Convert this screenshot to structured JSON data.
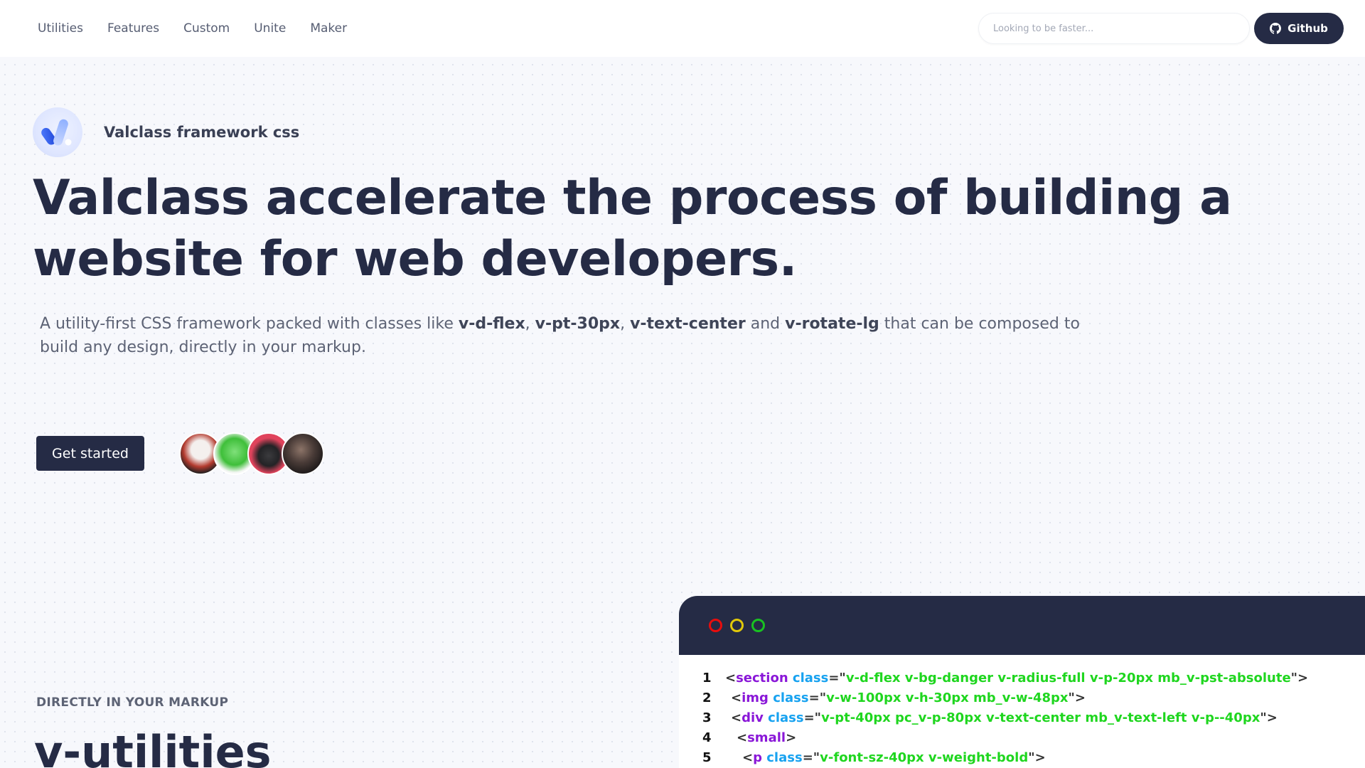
{
  "nav": {
    "links": [
      "Utilities",
      "Features",
      "Custom",
      "Unite",
      "Maker"
    ],
    "search_placeholder": "Looking to be faster...",
    "github_label": "Github"
  },
  "brand": {
    "name": "Valclass framework css",
    "logo_icon": "valclass-logo-icon"
  },
  "hero": {
    "headline_line1": "Valclass accelerate the process of building a",
    "headline_line2": "website for web developers.",
    "sub_1": "A utility-first CSS framework packed with classes like ",
    "kw_1": "v-d-flex",
    "sep_1": ", ",
    "kw_2": "v-pt-30px",
    "sep_2": ", ",
    "kw_3": "v-text-center",
    "sep_3": " and ",
    "kw_4": "v-rotate-lg",
    "sub_2": " that can be composed to build any design, directly in your markup.",
    "cta_label": "Get started"
  },
  "section": {
    "kicker": "DIRECTLY IN YOUR MARKUP",
    "title": "v-utilities"
  },
  "colors": {
    "primary": "#252b45",
    "tag": "#8a17d8",
    "attr": "#17a2f0",
    "string": "#1fd61f",
    "dot_red": "#e80d0d",
    "dot_yellow": "#e0c80a",
    "dot_green": "#19c221"
  },
  "code": {
    "lines": [
      {
        "n": "1",
        "open": "<",
        "tag": "section",
        "attr": "class",
        "eq": "=\"",
        "value": "v-d-flex v-bg-danger v-radius-full v-p-20px mb_v-pst-absolute",
        "close": "\">"
      },
      {
        "n": "2",
        "open": "<",
        "tag": "img",
        "attr": "class",
        "eq": "=\"",
        "value": "v-w-100px v-h-30px mb_v-w-48px",
        "close": "\">"
      },
      {
        "n": "3",
        "open": "<",
        "tag": "div",
        "attr": "class",
        "eq": "=\"",
        "value": "v-pt-40px pc_v-p-80px v-text-center mb_v-text-left v-p--40px",
        "close": "\">"
      },
      {
        "n": "4",
        "open": "<",
        "tag": "small",
        "close": ">"
      },
      {
        "n": "5",
        "open": "<",
        "tag": "p",
        "attr": "class",
        "eq": "=\"",
        "value": "v-font-sz-40px v-weight-bold",
        "close": "\">"
      }
    ]
  }
}
